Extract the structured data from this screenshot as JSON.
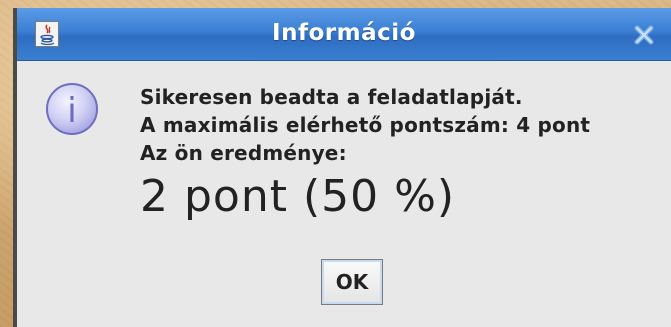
{
  "window": {
    "title": "Információ",
    "app_icon": "java-icon",
    "close_icon": "close-icon"
  },
  "dialog": {
    "icon": "info-icon",
    "icon_glyph": "i",
    "lines": [
      "Sikeresen beadta a feladatlapját.",
      "A maximális elérhető pontszám: 4 pont",
      "Az ön eredménye:"
    ],
    "score": "2 pont (50 %)"
  },
  "buttons": {
    "ok_label": "OK"
  },
  "colors": {
    "title_bar": "#3a7fd4",
    "dialog_bg": "#e8e8e8",
    "info_icon_fill": "#c9c9f2",
    "info_icon_stroke": "#6f6fbf"
  }
}
